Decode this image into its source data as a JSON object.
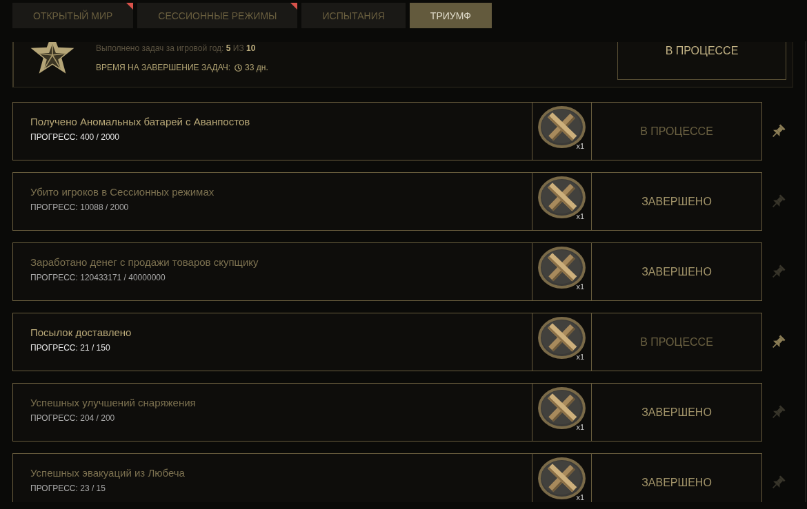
{
  "tabs": [
    {
      "label": "ОТКРЫТЫЙ МИР",
      "selected": false,
      "new": true
    },
    {
      "label": "СЕССИОННЫЕ РЕЖИМЫ",
      "selected": false,
      "new": true
    },
    {
      "label": "ИСПЫТАНИЯ",
      "selected": false,
      "new": false
    },
    {
      "label": "ТРИУМФ",
      "selected": true,
      "new": false
    }
  ],
  "summary": {
    "completed_text": "Выполнено задач за игровой год: **5** ИЗ **10**",
    "time_label": "ВРЕМЯ НА ЗАВЕРШЕНИЕ ЗАДАЧ:",
    "time_left": "33 дн.",
    "status": "В ПРОЦЕССЕ"
  },
  "tasks": [
    {
      "title": "Получено Аномальных батарей с Аванпостов",
      "progress": "ПРОГРЕСС: 400 / 2000",
      "reward_count": "x1",
      "status": "В ПРОЦЕССЕ",
      "completed": false
    },
    {
      "title": "Убито игроков в Сессионных режимах",
      "progress": "ПРОГРЕСС: 10088 / 2000",
      "reward_count": "x1",
      "status": "ЗАВЕРШЕНО",
      "completed": true
    },
    {
      "title": "Заработано денег с продажи товаров скупщику",
      "progress": "ПРОГРЕСС: 120433171 / 40000000",
      "reward_count": "x1",
      "status": "ЗАВЕРШЕНО",
      "completed": true
    },
    {
      "title": "Посылок доставлено",
      "progress": "ПРОГРЕСС: 21 / 150",
      "reward_count": "x1",
      "status": "В ПРОЦЕССЕ",
      "completed": false
    },
    {
      "title": "Успешных улучшений снаряжения",
      "progress": "ПРОГРЕСС: 204 / 200",
      "reward_count": "x1",
      "status": "ЗАВЕРШЕНО",
      "completed": true
    },
    {
      "title": "Успешных эвакуаций из Любеча",
      "progress": "ПРОГРЕСС: 23 / 15",
      "reward_count": "x1",
      "status": "ЗАВЕРШЕНО",
      "completed": true
    }
  ]
}
